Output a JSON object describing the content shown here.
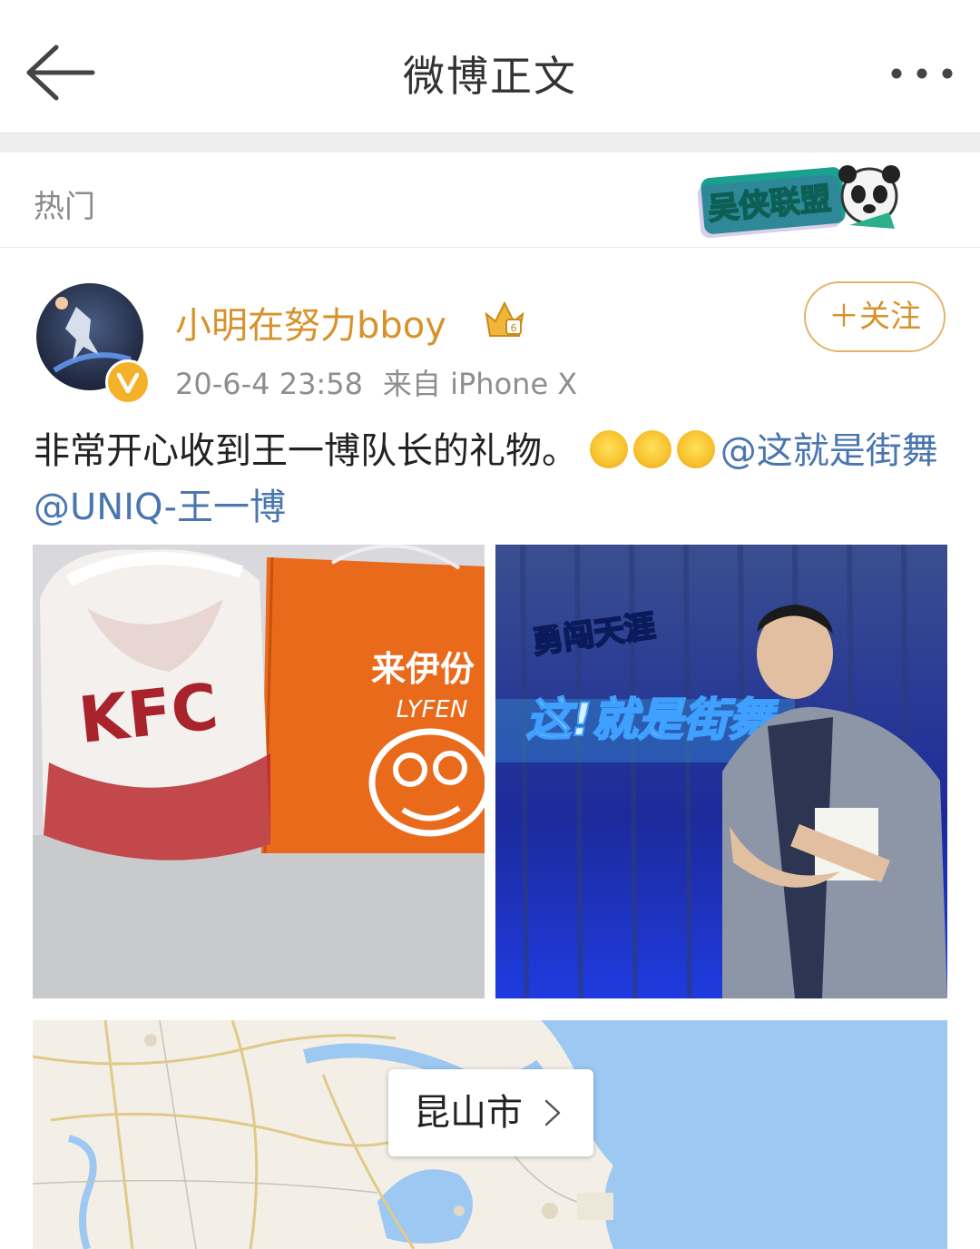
{
  "header": {
    "title": "微博正文"
  },
  "section": {
    "label": "热门",
    "badge_text": "吴侠联盟"
  },
  "post": {
    "username": "小明在努力bboy",
    "timestamp": "20-6-4 23:58",
    "source_prefix": "来自",
    "device": "iPhone X",
    "follow_label": "＋关注",
    "text": "非常开心收到王一博队长的礼物。",
    "emojis": [
      "emoji-face",
      "emoji-face",
      "emoji-face"
    ],
    "mention1": "@这就是街舞",
    "mention2": "@UNIQ-王一博",
    "photo1": {
      "labels": [
        "KFC",
        "来伊份",
        "LYFEN"
      ]
    },
    "photo2": {
      "labels": [
        "勇闯天涯",
        "这!就是街舞"
      ]
    },
    "location": "昆山市"
  },
  "icons": {
    "back": "arrow-left-icon",
    "more": "more-dots-icon",
    "verified": "verified-v-icon",
    "crown": "vip-crown-icon",
    "chevron": "chevron-right-icon"
  },
  "colors": {
    "username": "#d8922c",
    "mention": "#4a76b0",
    "follow_border": "#e4b368",
    "meta": "#8e8e8e"
  }
}
